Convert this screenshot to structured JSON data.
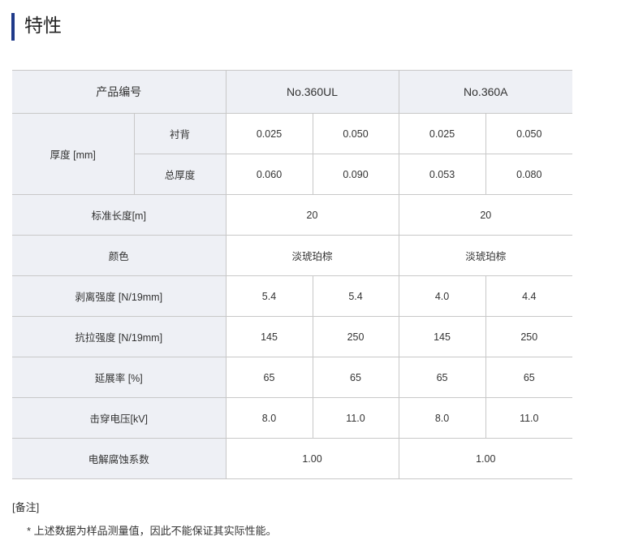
{
  "title": "特性",
  "table": {
    "header": {
      "label": "产品编号",
      "col1": "No.360UL",
      "col2": "No.360A"
    },
    "thickness": {
      "label": "厚度 [mm]",
      "backing": {
        "label": "衬背",
        "values": [
          "0.025",
          "0.050",
          "0.025",
          "0.050"
        ]
      },
      "total": {
        "label": "总厚度",
        "values": [
          "0.060",
          "0.090",
          "0.053",
          "0.080"
        ]
      }
    },
    "length": {
      "label": "标准长度[m]",
      "values": [
        "20",
        "20"
      ]
    },
    "color": {
      "label": "颜色",
      "values": [
        "淡琥珀棕",
        "淡琥珀棕"
      ]
    },
    "peel": {
      "label": "剥离强度 [N/19mm]",
      "values": [
        "5.4",
        "5.4",
        "4.0",
        "4.4"
      ]
    },
    "tensile": {
      "label": "抗拉强度 [N/19mm]",
      "values": [
        "145",
        "250",
        "145",
        "250"
      ]
    },
    "elongation": {
      "label": "延展率 [%]",
      "values": [
        "65",
        "65",
        "65",
        "65"
      ]
    },
    "breakdown": {
      "label": "击穿电压[kV]",
      "values": [
        "8.0",
        "11.0",
        "8.0",
        "11.0"
      ]
    },
    "corrosion": {
      "label": "电解腐蚀系数",
      "values": [
        "1.00",
        "1.00"
      ]
    }
  },
  "notes": {
    "title": "[备注]",
    "item": "* 上述数据为样品测量值，因此不能保证其实际性能。"
  },
  "colors": {
    "accent": "#1f3a8a",
    "header_bg": "#eef0f5",
    "border": "#c8c8c8"
  }
}
